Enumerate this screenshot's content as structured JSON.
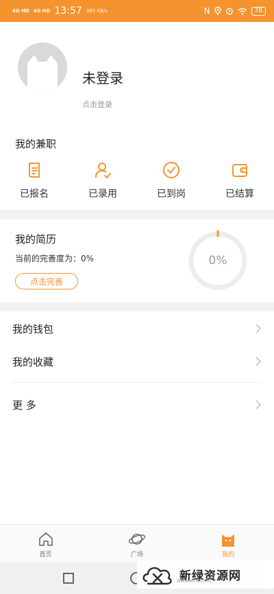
{
  "status_bar": {
    "signal1": "4G HD",
    "signal2": "4G HD",
    "time": "13:57",
    "net_speed": "385 KB/s",
    "battery": "78"
  },
  "profile": {
    "name": "未登录",
    "hint": "点击登录"
  },
  "jobs": {
    "title": "我的兼职",
    "items": [
      {
        "label": "已报名",
        "icon": "document-icon"
      },
      {
        "label": "已录用",
        "icon": "user-check-icon"
      },
      {
        "label": "已到岗",
        "icon": "check-circle-icon"
      },
      {
        "label": "已结算",
        "icon": "wallet-icon"
      }
    ]
  },
  "resume": {
    "title": "我的简历",
    "completeness_label": "当前的完善度为：0%",
    "button_label": "点击完善",
    "progress_percent": 0,
    "progress_text": "0%"
  },
  "menu": {
    "wallet": "我的钱包",
    "favorites": "我的收藏",
    "more": "更 多"
  },
  "tabbar": {
    "items": [
      {
        "label": "首页",
        "icon": "home-icon",
        "active": false
      },
      {
        "label": "广场",
        "icon": "planet-icon",
        "active": false
      },
      {
        "label": "我的",
        "icon": "cat-icon",
        "active": true
      }
    ]
  },
  "watermark": {
    "text": "新绿资源网",
    "url": "www.xlhs.com"
  },
  "colors": {
    "accent": "#f5932f",
    "band": "#f2f2f2"
  }
}
